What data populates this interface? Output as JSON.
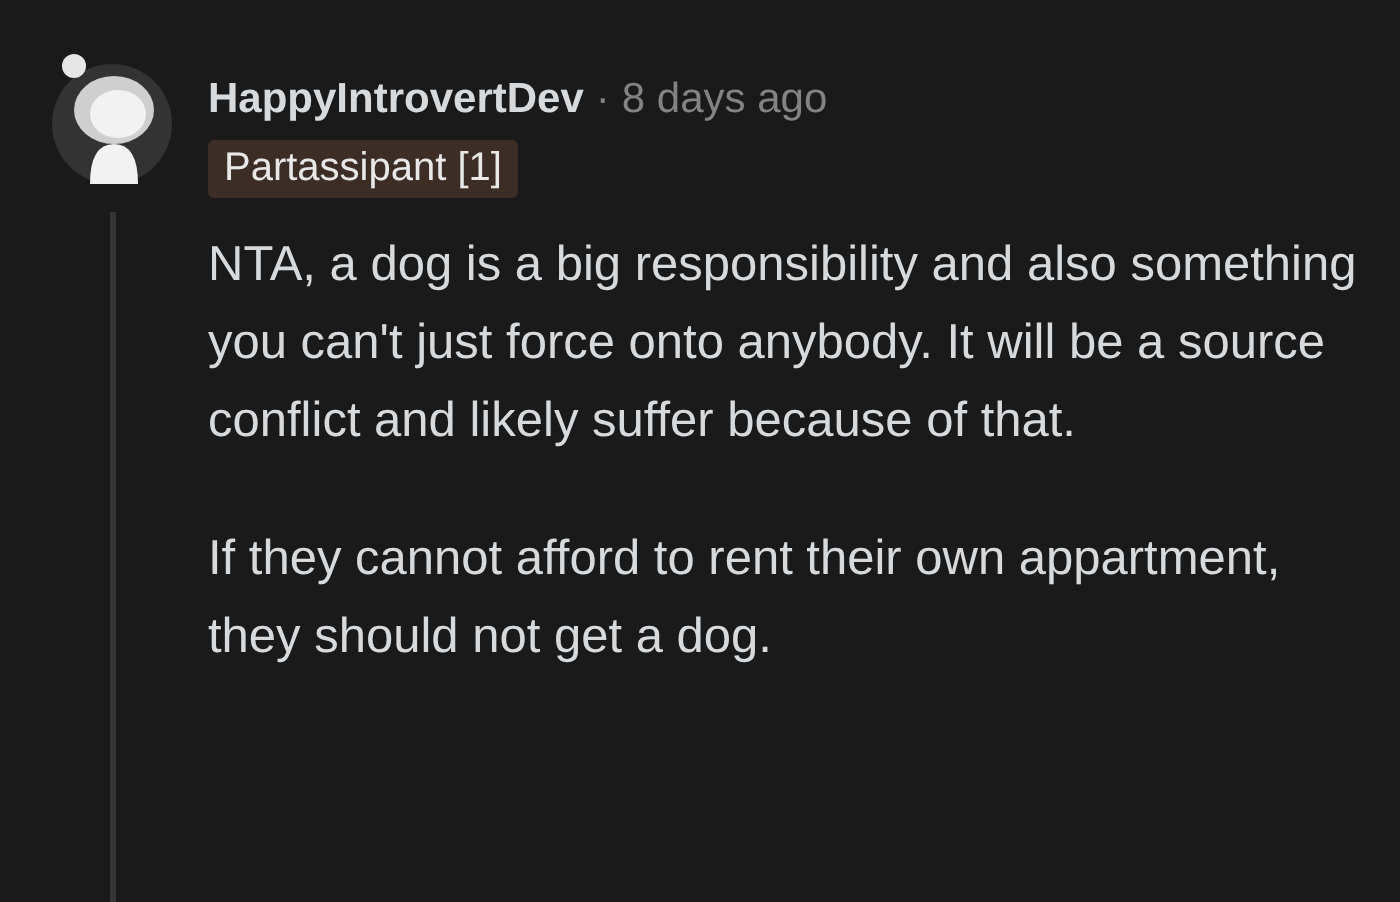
{
  "comment": {
    "author": "HappyIntrovertDev",
    "separator": "·",
    "time": "8 days ago",
    "flair": "Partassipant [1]",
    "paragraphs": [
      "NTA, a dog is a big responsibility and also something you can't just force onto anybody. It will be a source conflict and likely suffer because of that.",
      "If they cannot afford to rent their own appartment, they should not get a dog."
    ]
  }
}
